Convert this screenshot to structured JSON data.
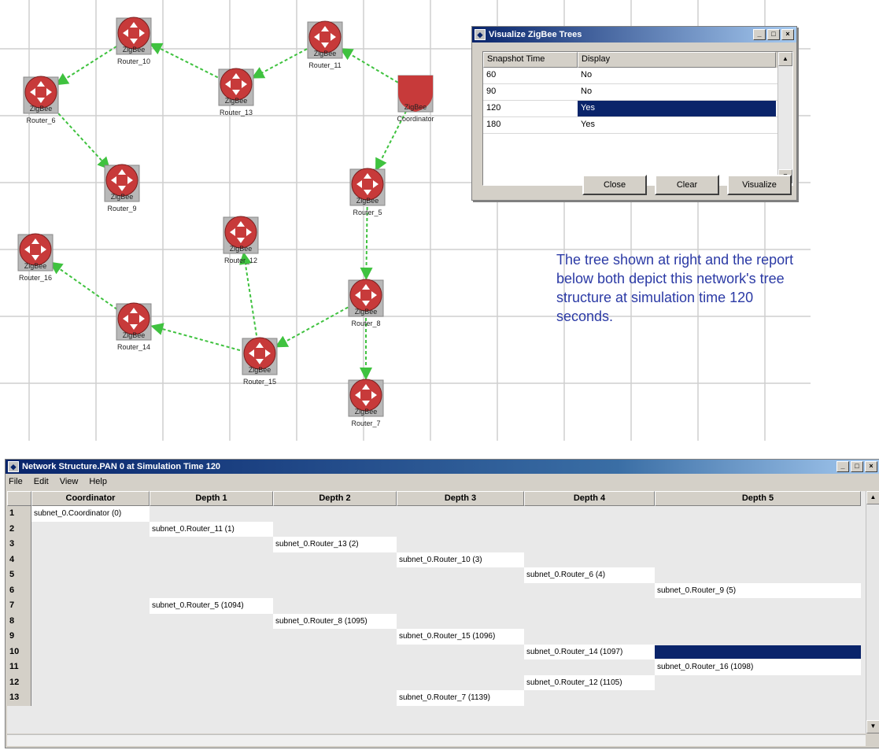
{
  "network": {
    "nodes": [
      {
        "id": "router_10",
        "label": "Router_10"
      },
      {
        "id": "router_11",
        "label": "Router_11"
      },
      {
        "id": "router_6",
        "label": "Router_6"
      },
      {
        "id": "router_13",
        "label": "Router_13"
      },
      {
        "id": "coordinator",
        "label": "Coordinator"
      },
      {
        "id": "router_9",
        "label": "Router_9"
      },
      {
        "id": "router_5",
        "label": "Router_5"
      },
      {
        "id": "router_12",
        "label": "Router_12"
      },
      {
        "id": "router_16",
        "label": "Router_16"
      },
      {
        "id": "router_8",
        "label": "Router_8"
      },
      {
        "id": "router_14",
        "label": "Router_14"
      },
      {
        "id": "router_15",
        "label": "Router_15"
      },
      {
        "id": "router_7",
        "label": "Router_7"
      }
    ],
    "node_badge": "ZigBee",
    "edge_color": "#3fc23f",
    "node_color": "#c73a3a"
  },
  "snapshot_dialog": {
    "title": "Visualize ZigBee Trees",
    "columns": [
      "Snapshot Time",
      "Display"
    ],
    "rows": [
      {
        "time": "60",
        "display": "No"
      },
      {
        "time": "90",
        "display": "No"
      },
      {
        "time": "120",
        "display": "Yes",
        "selected": true
      },
      {
        "time": "180",
        "display": "Yes"
      }
    ],
    "buttons": {
      "close": "Close",
      "clear": "Clear",
      "visualize": "Visualize"
    }
  },
  "annotation": "The tree shown at right and the report below both depict this network's tree structure at simulation time 120 seconds.",
  "structure_window": {
    "title": "Network Structure.PAN 0 at Simulation Time 120",
    "menu": [
      "File",
      "Edit",
      "View",
      "Help"
    ],
    "columns": [
      "Coordinator",
      "Depth 1",
      "Depth 2",
      "Depth 3",
      "Depth 4",
      "Depth 5"
    ],
    "rows": [
      {
        "n": "1",
        "col": 0,
        "text": "subnet_0.Coordinator (0)"
      },
      {
        "n": "2",
        "col": 1,
        "text": "subnet_0.Router_11 (1)"
      },
      {
        "n": "3",
        "col": 2,
        "text": "subnet_0.Router_13 (2)"
      },
      {
        "n": "4",
        "col": 3,
        "text": "subnet_0.Router_10 (3)"
      },
      {
        "n": "5",
        "col": 4,
        "text": "subnet_0.Router_6 (4)"
      },
      {
        "n": "6",
        "col": 5,
        "text": "subnet_0.Router_9 (5)"
      },
      {
        "n": "7",
        "col": 1,
        "text": "subnet_0.Router_5 (1094)"
      },
      {
        "n": "8",
        "col": 2,
        "text": "subnet_0.Router_8 (1095)"
      },
      {
        "n": "9",
        "col": 3,
        "text": "subnet_0.Router_15 (1096)"
      },
      {
        "n": "10",
        "col": 4,
        "text": "subnet_0.Router_14 (1097)",
        "selected_next": true
      },
      {
        "n": "11",
        "col": 5,
        "text": "subnet_0.Router_16 (1098)"
      },
      {
        "n": "12",
        "col": 4,
        "text": "subnet_0.Router_12 (1105)"
      },
      {
        "n": "13",
        "col": 3,
        "text": "subnet_0.Router_7 (1139)"
      }
    ]
  }
}
